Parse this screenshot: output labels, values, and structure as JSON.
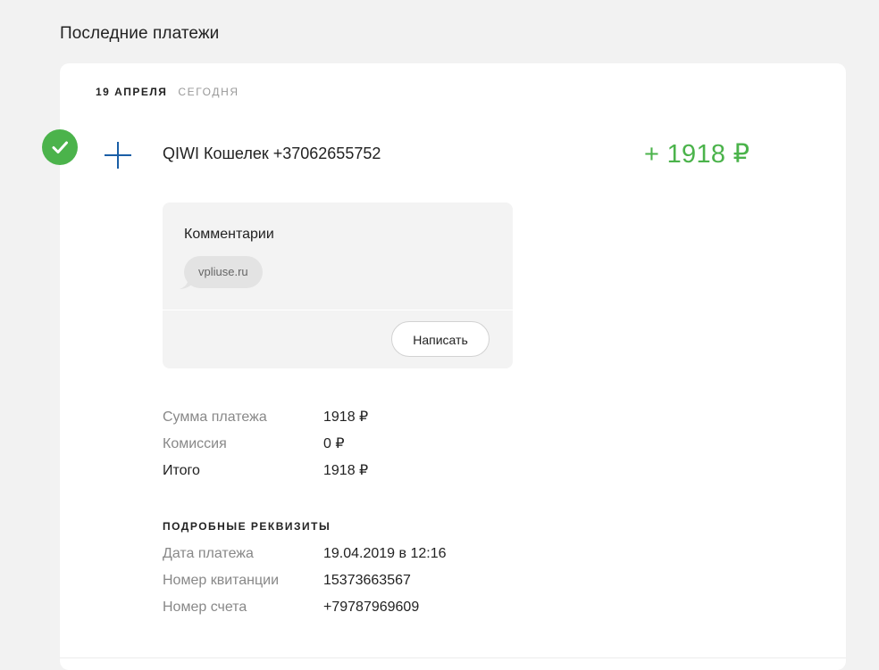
{
  "page": {
    "title": "Последние платежи"
  },
  "group": {
    "date": "19 апреля",
    "relative": "сегодня"
  },
  "payment": {
    "status_icon": "check-icon",
    "type_icon": "plus-icon",
    "payee": "QIWI Кошелек +37062655752",
    "amount": "+ 1918 ₽",
    "amount_color": "#4bb34b"
  },
  "comments": {
    "title": "Комментарии",
    "items": [
      "vpliuse.ru"
    ],
    "write_label": "Написать"
  },
  "summary": [
    {
      "label": "Сумма платежа",
      "value": "1918 ₽"
    },
    {
      "label": "Комиссия",
      "value": "0 ₽"
    },
    {
      "label": "Итого",
      "value": "1918 ₽"
    }
  ],
  "details": {
    "title": "ПОДРОБНЫЕ РЕКВИЗИТЫ",
    "rows": [
      {
        "label": "Дата платежа",
        "value": "19.04.2019 в 12:16"
      },
      {
        "label": "Номер квитанции",
        "value": "15373663567"
      },
      {
        "label": "Номер счета",
        "value": "+79787969609"
      }
    ]
  },
  "colors": {
    "accent_green": "#4bb34b",
    "icon_blue": "#1a5ea6",
    "background": "#f2f2f2"
  }
}
